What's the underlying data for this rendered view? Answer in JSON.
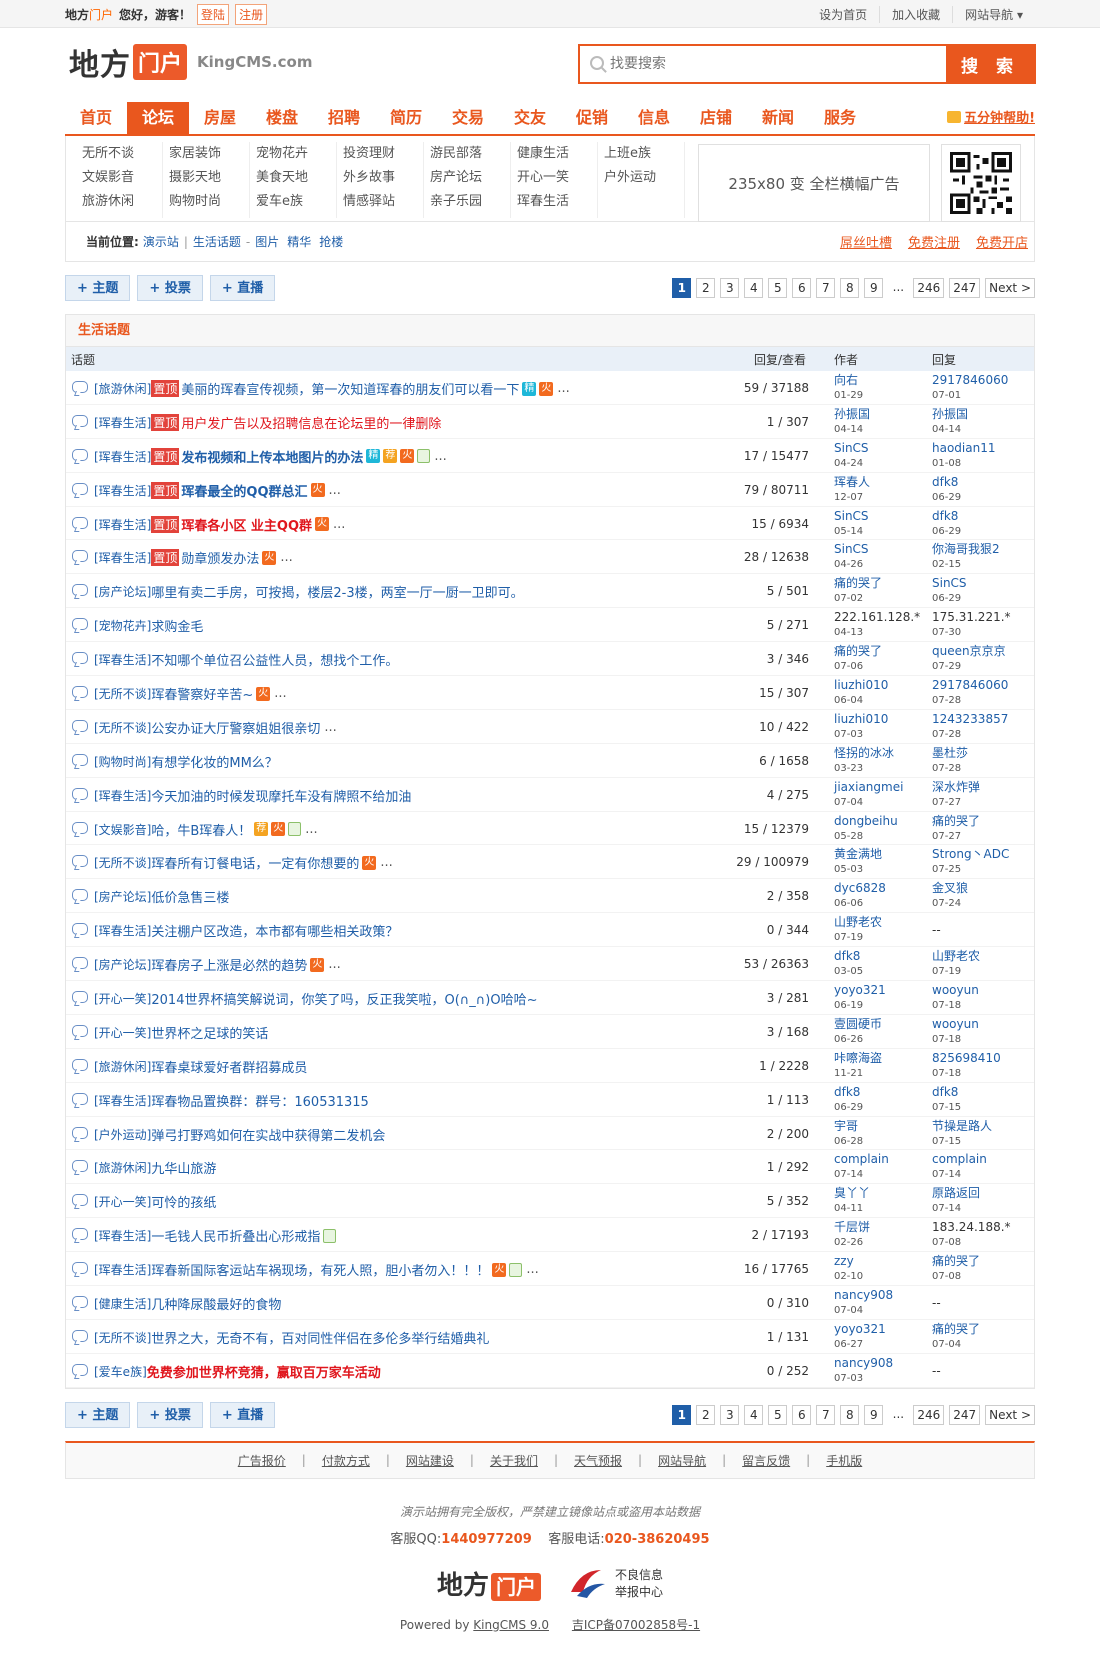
{
  "topbar": {
    "site_a": "地方",
    "site_b": "门户",
    "greeting": "您好，游客！",
    "login": "登陆",
    "register": "注册",
    "links": [
      "设为首页",
      "加入收藏",
      "网站导航 ▾"
    ]
  },
  "header": {
    "logo_a": "地方",
    "logo_b": "门户",
    "logo_domain": "KingCMS.com",
    "search_placeholder": "找要搜索",
    "search_button": "搜 索"
  },
  "nav": {
    "items": [
      "首页",
      "论坛",
      "房屋",
      "楼盘",
      "招聘",
      "简历",
      "交易",
      "交友",
      "促销",
      "信息",
      "店铺",
      "新闻",
      "服务"
    ],
    "active": 1,
    "help": "五分钟帮助!"
  },
  "subnav": {
    "cols": [
      [
        "无所不谈",
        "文娱影音",
        "旅游休闲"
      ],
      [
        "家居装饰",
        "摄影天地",
        "购物时尚"
      ],
      [
        "宠物花卉",
        "美食天地",
        "爱车e族"
      ],
      [
        "投资理财",
        "外乡故事",
        "情感驿站"
      ],
      [
        "游民部落",
        "房产论坛",
        "亲子乐园"
      ],
      [
        "健康生活",
        "开心一笑",
        "珲春生活"
      ],
      [
        "上班e族",
        "户外运动",
        ""
      ]
    ],
    "ad_text": "235x80 变 全栏横幅广告"
  },
  "crumbs": {
    "label": "当前位置:",
    "site": "演示站",
    "board": "生活话题",
    "links": [
      "图片",
      "精华",
      "抢楼"
    ],
    "right": [
      "屌丝吐槽",
      "免费注册",
      "免费开店"
    ]
  },
  "actions": [
    "+ 主题",
    "+ 投票",
    "+ 直播"
  ],
  "pager": [
    "1",
    "2",
    "3",
    "4",
    "5",
    "6",
    "7",
    "8",
    "9",
    "...",
    "246",
    "247",
    "Next >"
  ],
  "board": {
    "title": "生活话题",
    "headers": {
      "topic": "话题",
      "stat": "回复/查看",
      "author": "作者",
      "reply": "回复"
    },
    "rows": [
      {
        "cat": "[旅游休闲]",
        "top": true,
        "subj": "美丽的珲春宣传视频，第一次知道珲春的朋友们可以看一下",
        "style": "",
        "tags": [
          "jing",
          "huo"
        ],
        "more": true,
        "stat": "59 / 37188",
        "au": "向右",
        "ad": "01-29",
        "rp": "2917846060",
        "rd": "07-01"
      },
      {
        "cat": "[珲春生活]",
        "top": true,
        "subj": "用户发广告以及招聘信息在论坛里的一律删除",
        "style": "redn",
        "tags": [],
        "more": false,
        "stat": "1 / 307",
        "au": "孙振国",
        "ad": "04-14",
        "rp": "孙振国",
        "rd": "04-14"
      },
      {
        "cat": "[珲春生活]",
        "top": true,
        "subj": "发布视频和上传本地图片的办法",
        "style": "b",
        "tags": [
          "jing",
          "jian",
          "huo",
          "img"
        ],
        "more": true,
        "stat": "17 / 15477",
        "au": "SinCS",
        "ad": "04-24",
        "rp": "haodian11",
        "rd": "01-08"
      },
      {
        "cat": "[珲春生活]",
        "top": true,
        "subj": "珲春最全的QQ群总汇",
        "style": "b",
        "tags": [
          "huo"
        ],
        "more": true,
        "stat": "79 / 80711",
        "au": "珲春人",
        "ad": "12-07",
        "rp": "dfk8",
        "rd": "06-29"
      },
      {
        "cat": "[珲春生活]",
        "top": true,
        "subj": "珲春各小区 业主QQ群",
        "style": "red",
        "tags": [
          "huo"
        ],
        "more": true,
        "stat": "15 / 6934",
        "au": "SinCS",
        "ad": "05-14",
        "rp": "dfk8",
        "rd": "06-29"
      },
      {
        "cat": "[珲春生活]",
        "top": true,
        "subj": "勋章颁发办法",
        "style": "",
        "tags": [
          "huo"
        ],
        "more": true,
        "stat": "28 / 12638",
        "au": "SinCS",
        "ad": "04-26",
        "rp": "你海哥我狠2",
        "rd": "02-15"
      },
      {
        "cat": "[房产论坛]",
        "top": false,
        "subj": "哪里有卖二手房，可按揭，楼层2-3楼，两室一厅一厨一卫即可。",
        "style": "",
        "tags": [],
        "more": false,
        "stat": "5 / 501",
        "au": "痛的哭了",
        "ad": "07-02",
        "rp": "SinCS",
        "rd": "06-29"
      },
      {
        "cat": "[宠物花卉]",
        "top": false,
        "subj": "求购金毛",
        "style": "",
        "tags": [],
        "more": false,
        "stat": "5 / 271",
        "au": "222.161.128.*",
        "ad": "04-13",
        "rp": "175.31.221.*",
        "rd": "07-30",
        "plain": true
      },
      {
        "cat": "[珲春生活]",
        "top": false,
        "subj": "不知哪个单位召公益性人员，想找个工作。",
        "style": "",
        "tags": [],
        "more": false,
        "stat": "3 / 346",
        "au": "痛的哭了",
        "ad": "07-06",
        "rp": "queen京京京",
        "rd": "07-29"
      },
      {
        "cat": "[无所不谈]",
        "top": false,
        "subj": "珲春警察好辛苦~",
        "style": "",
        "tags": [
          "huo"
        ],
        "more": true,
        "stat": "15 / 307",
        "au": "liuzhi010",
        "ad": "06-04",
        "rp": "2917846060",
        "rd": "07-28"
      },
      {
        "cat": "[无所不谈]",
        "top": false,
        "subj": "公安办证大厅警察姐姐很亲切",
        "style": "",
        "tags": [],
        "more": true,
        "stat": "10 / 422",
        "au": "liuzhi010",
        "ad": "07-03",
        "rp": "1243233857",
        "rd": "07-28"
      },
      {
        "cat": "[购物时尚]",
        "top": false,
        "subj": "有想学化妆的MM么？",
        "style": "",
        "tags": [],
        "more": false,
        "stat": "6 / 1658",
        "au": "怪拐的冰冰",
        "ad": "03-23",
        "rp": "墨杜莎",
        "rd": "07-28"
      },
      {
        "cat": "[珲春生活]",
        "top": false,
        "subj": "今天加油的时候发现摩托车没有牌照不给加油",
        "style": "",
        "tags": [],
        "more": false,
        "stat": "4 / 275",
        "au": "jiaxiangmei",
        "ad": "07-04",
        "rp": "深水炸弹",
        "rd": "07-27"
      },
      {
        "cat": "[文娱影音]",
        "top": false,
        "subj": "哈，牛B珲春人！",
        "style": "",
        "tags": [
          "jian",
          "huo",
          "img"
        ],
        "more": true,
        "stat": "15 / 12379",
        "au": "dongbeihu",
        "ad": "05-28",
        "rp": "痛的哭了",
        "rd": "07-27"
      },
      {
        "cat": "[无所不谈]",
        "top": false,
        "subj": "珲春所有订餐电话，一定有你想要的",
        "style": "",
        "tags": [
          "huo"
        ],
        "more": true,
        "stat": "29 / 100979",
        "au": "黄金满地",
        "ad": "05-03",
        "rp": "Strong丶ADC",
        "rd": "07-25"
      },
      {
        "cat": "[房产论坛]",
        "top": false,
        "subj": "低价急售三楼",
        "style": "",
        "tags": [],
        "more": false,
        "stat": "2 / 358",
        "au": "dyc6828",
        "ad": "06-06",
        "rp": "金叉狼",
        "rd": "07-24"
      },
      {
        "cat": "[珲春生活]",
        "top": false,
        "subj": "关注棚户区改造，本市都有哪些相关政策？",
        "style": "",
        "tags": [],
        "more": false,
        "stat": "0 / 344",
        "au": "山野老农",
        "ad": "07-19",
        "rp": "--",
        "rd": "",
        "rplain": true
      },
      {
        "cat": "[房产论坛]",
        "top": false,
        "subj": "珲春房子上涨是必然的趋势",
        "style": "",
        "tags": [
          "huo"
        ],
        "more": true,
        "stat": "53 / 26363",
        "au": "dfk8",
        "ad": "03-05",
        "rp": "山野老农",
        "rd": "07-19"
      },
      {
        "cat": "[开心一笑]",
        "top": false,
        "subj": "2014世界杯搞笑解说词，你笑了吗，反正我笑啦，O(∩_∩)O哈哈~",
        "style": "",
        "tags": [],
        "more": false,
        "stat": "3 / 281",
        "au": "yoyo321",
        "ad": "06-19",
        "rp": "wooyun",
        "rd": "07-18"
      },
      {
        "cat": "[开心一笑]",
        "top": false,
        "subj": "世界杯之足球的笑话",
        "style": "",
        "tags": [],
        "more": false,
        "stat": "3 / 168",
        "au": "壹圆硬币",
        "ad": "06-26",
        "rp": "wooyun",
        "rd": "07-18"
      },
      {
        "cat": "[旅游休闲]",
        "top": false,
        "subj": "珲春桌球爱好者群招募成员",
        "style": "",
        "tags": [],
        "more": false,
        "stat": "1 / 2228",
        "au": "咔嚓海盗",
        "ad": "11-21",
        "rp": "825698410",
        "rd": "07-18"
      },
      {
        "cat": "[珲春生活]",
        "top": false,
        "subj": "珲春物品置换群：群号：160531315",
        "style": "",
        "tags": [],
        "more": false,
        "stat": "1 / 113",
        "au": "dfk8",
        "ad": "06-29",
        "rp": "dfk8",
        "rd": "07-15"
      },
      {
        "cat": "[户外运动]",
        "top": false,
        "subj": "弹弓打野鸡如何在实战中获得第二发机会",
        "style": "",
        "tags": [],
        "more": false,
        "stat": "2 / 200",
        "au": "宇哥",
        "ad": "06-28",
        "rp": "节操是路人",
        "rd": "07-15"
      },
      {
        "cat": "[旅游休闲]",
        "top": false,
        "subj": "九华山旅游",
        "style": "",
        "tags": [],
        "more": false,
        "stat": "1 / 292",
        "au": "complain",
        "ad": "07-14",
        "rp": "complain",
        "rd": "07-14"
      },
      {
        "cat": "[开心一笑]",
        "top": false,
        "subj": "可怜的孩纸",
        "style": "",
        "tags": [],
        "more": false,
        "stat": "5 / 352",
        "au": "臭丫丫",
        "ad": "04-11",
        "rp": "原路返回",
        "rd": "07-14"
      },
      {
        "cat": "[珲春生活]",
        "top": false,
        "subj": "一毛钱人民币折叠出心形戒指",
        "style": "",
        "tags": [
          "img"
        ],
        "more": false,
        "stat": "2 / 17193",
        "au": "千层饼",
        "ad": "02-26",
        "rp": "183.24.188.*",
        "rd": "07-08",
        "rplain": true
      },
      {
        "cat": "[珲春生活]",
        "top": false,
        "subj": "珲春新国际客运站车祸现场，有死人照，胆小者勿入！！！",
        "style": "",
        "tags": [
          "huo",
          "img"
        ],
        "more": true,
        "stat": "16 / 17765",
        "au": "zzy",
        "ad": "02-10",
        "rp": "痛的哭了",
        "rd": "07-08"
      },
      {
        "cat": "[健康生活]",
        "top": false,
        "subj": "几种降尿酸最好的食物",
        "style": "",
        "tags": [],
        "more": false,
        "stat": "0 / 310",
        "au": "nancy908",
        "ad": "07-04",
        "rp": "--",
        "rd": "",
        "rplain": true
      },
      {
        "cat": "[无所不谈]",
        "top": false,
        "subj": "世界之大，无奇不有，百对同性伴侣在多伦多举行结婚典礼",
        "style": "",
        "tags": [],
        "more": false,
        "stat": "1 / 131",
        "au": "yoyo321",
        "ad": "06-27",
        "rp": "痛的哭了",
        "rd": "07-04"
      },
      {
        "cat": "[爱车e族]",
        "top": false,
        "subj": "免费参加世界杯竞猜，赢取百万家车活动",
        "style": "red",
        "tags": [],
        "more": false,
        "stat": "0 / 252",
        "au": "nancy908",
        "ad": "07-03",
        "rp": "--",
        "rd": "",
        "rplain": true
      }
    ]
  },
  "tag_labels": {
    "top": "置顶",
    "jing": "精",
    "jian": "荐",
    "huo": "火",
    "img": "",
    "more": "..."
  },
  "footer": {
    "links": [
      "广告报价",
      "付款方式",
      "网站建设",
      "关于我们",
      "天气预报",
      "网站导航",
      "留言反馈",
      "手机版"
    ],
    "copyright": "演示站拥有完全版权，严禁建立镜像站点或盗用本站数据",
    "qq_label": "客服QQ:",
    "qq": "1440977209",
    "tel_label": "客服电话:",
    "tel": "020-38620495",
    "logo_a": "地方",
    "logo_b": "门户",
    "report_1": "不良信息",
    "report_2": "举报中心",
    "powered_prefix": "Powered by",
    "powered_link": "KingCMS 9.0",
    "icp": "吉ICP备07002858号-1"
  }
}
